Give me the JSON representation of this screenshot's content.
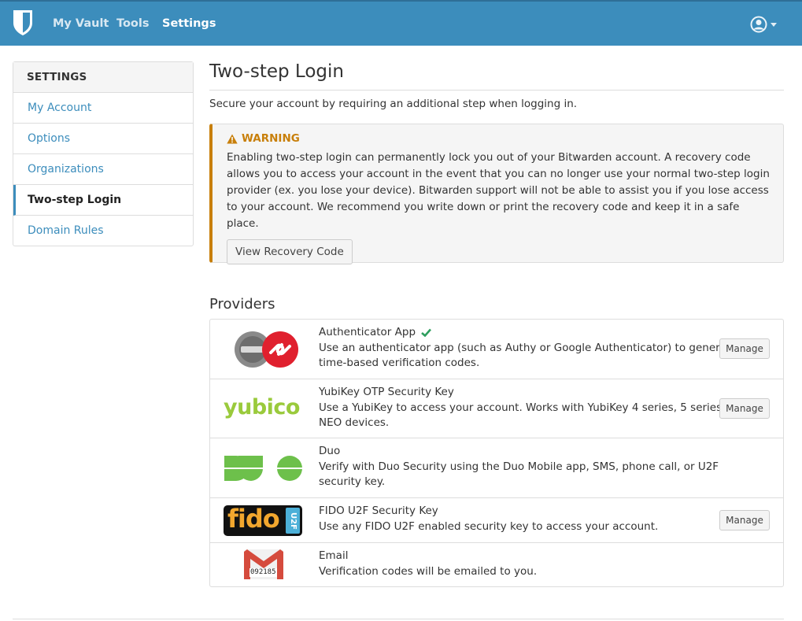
{
  "nav": {
    "links": [
      {
        "label": "My Vault"
      },
      {
        "label": "Tools"
      },
      {
        "label": "Settings"
      }
    ]
  },
  "sidebar": {
    "header": "SETTINGS",
    "items": [
      {
        "label": "My Account"
      },
      {
        "label": "Options"
      },
      {
        "label": "Organizations"
      },
      {
        "label": "Two-step Login",
        "active": true
      },
      {
        "label": "Domain Rules"
      }
    ]
  },
  "page": {
    "title": "Two-step Login",
    "intro": "Secure your account by requiring an additional step when logging in."
  },
  "warning": {
    "title": "WARNING",
    "text": "Enabling two-step login can permanently lock you out of your Bitwarden account. A recovery code allows you to access your account in the event that you can no longer use your normal two-step login provider (ex. you lose your device). Bitwarden support will not be able to assist you if you lose access to your account. We recommend you write down or print the recovery code and keep it in a safe place.",
    "button": "View Recovery Code"
  },
  "providers": {
    "title": "Providers",
    "items": [
      {
        "name": "Authenticator App",
        "enabled": true,
        "description": "Use an authenticator app (such as Authy or Google Authenticator) to generate time-based verification codes.",
        "action": "Manage",
        "logo": "authenticator-logo"
      },
      {
        "name": "YubiKey OTP Security Key",
        "description": "Use a YubiKey to access your account. Works with YubiKey 4 series, 5 series, and NEO devices.",
        "action": "Manage",
        "logo": "yubico-logo",
        "logo_text": "yubico"
      },
      {
        "name": "Duo",
        "description": "Verify with Duo Security using the Duo Mobile app, SMS, phone call, or U2F security key.",
        "logo": "duo-logo"
      },
      {
        "name": "FIDO U2F Security Key",
        "description": "Use any FIDO U2F enabled security key to access your account.",
        "action": "Manage",
        "logo": "fido-logo",
        "logo_text": "fido",
        "logo_badge": "U2F"
      },
      {
        "name": "Email",
        "description": "Verification codes will be emailed to you.",
        "logo": "gmail-logo",
        "logo_code": "092185"
      }
    ]
  },
  "colors": {
    "primary": "#3c8dbc",
    "warning": "#c87f0a",
    "success": "#2e9e5e"
  }
}
